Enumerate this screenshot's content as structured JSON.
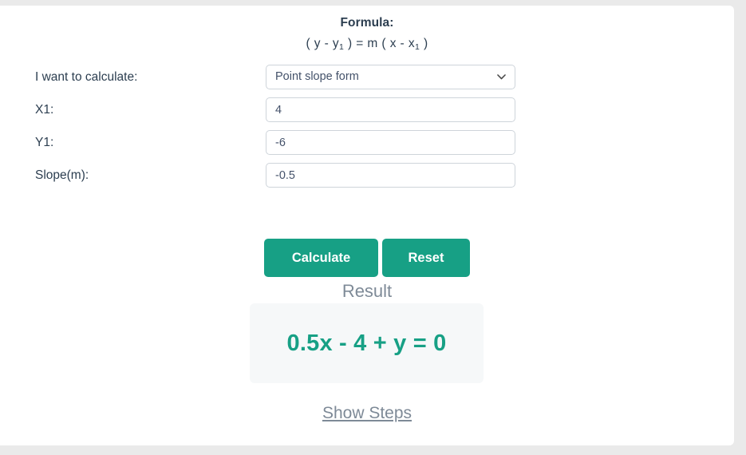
{
  "formula": {
    "title": "Formula:",
    "lhs_open": "( y - y",
    "lhs_sub": "1",
    "lhs_close": " ) = m ( x - x",
    "rhs_sub": "1",
    "rhs_close": " )",
    "expression_plain": "( y - y1 ) = m ( x - x1 )"
  },
  "form": {
    "rows": [
      {
        "label": "I want to calculate:",
        "type": "select",
        "value": "Point slope form",
        "icon": "chevron-down-icon"
      },
      {
        "label": "X1:",
        "type": "text",
        "value": "4",
        "placeholder": ""
      },
      {
        "label": "Y1:",
        "type": "text",
        "value": "-6",
        "placeholder": ""
      },
      {
        "label": "Slope(m):",
        "type": "text",
        "value": "-0.5",
        "placeholder": ""
      }
    ]
  },
  "actions": {
    "calculate_label": "Calculate",
    "reset_label": "Reset"
  },
  "result": {
    "heading": "Result",
    "value": "0.5x - 4 + y = 0",
    "show_steps_label": "Show Steps"
  },
  "colors": {
    "accent_teal": "#17a085",
    "text_dark": "#2c3e50",
    "text_muted": "#7e8a97",
    "border": "#ced4da",
    "result_bg": "#f6f8f9",
    "page_bg": "#eaeaea"
  }
}
